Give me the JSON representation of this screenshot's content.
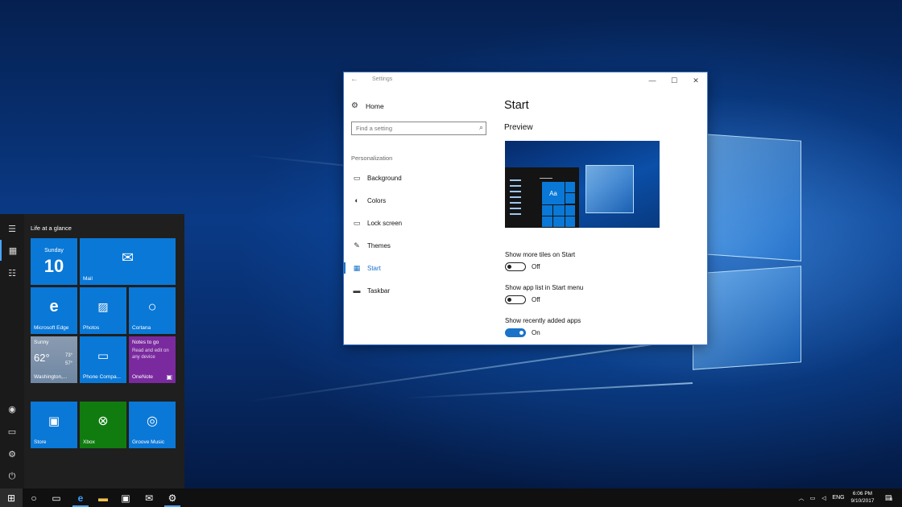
{
  "settings": {
    "window_title": "Settings",
    "home_label": "Home",
    "search_placeholder": "Find a setting",
    "section_label": "Personalization",
    "nav": [
      {
        "label": "Background",
        "icon": "picture-icon"
      },
      {
        "label": "Colors",
        "icon": "palette-icon"
      },
      {
        "label": "Lock screen",
        "icon": "lock-screen-icon"
      },
      {
        "label": "Themes",
        "icon": "brush-icon"
      },
      {
        "label": "Start",
        "icon": "start-icon",
        "selected": true
      },
      {
        "label": "Taskbar",
        "icon": "taskbar-icon"
      }
    ],
    "page_title": "Start",
    "preview_heading": "Preview",
    "preview_tile_text": "Aa",
    "options": [
      {
        "label": "Show more tiles on Start",
        "state": "Off",
        "on": false
      },
      {
        "label": "Show app list in Start menu",
        "state": "Off",
        "on": false
      },
      {
        "label": "Show recently added apps",
        "state": "On",
        "on": true
      }
    ]
  },
  "start_menu": {
    "group_title": "Life at a glance",
    "calendar": {
      "day": "Sunday",
      "date": "10"
    },
    "tiles": {
      "mail": "Mail",
      "edge": "Microsoft Edge",
      "photos": "Photos",
      "cortana": "Cortana",
      "weather_condition": "Sunny",
      "weather_temp": "62°",
      "weather_high": "73°",
      "weather_low": "57°",
      "weather_location": "Washington,...",
      "phone": "Phone Compa...",
      "onenote_title": "Notes to go",
      "onenote_sub": "Read and edit on any device",
      "onenote": "OneNote",
      "store": "Store",
      "xbox": "Xbox",
      "groove": "Groove Music"
    }
  },
  "taskbar": {
    "language": "ENG",
    "time": "6:06 PM",
    "date": "9/10/2017",
    "notification_count": "6"
  },
  "colors": {
    "accent": "#0a78d7",
    "xbox_green": "#107c10",
    "onenote_purple": "#7a2a9e",
    "selection_blue": "#1a73c8"
  }
}
